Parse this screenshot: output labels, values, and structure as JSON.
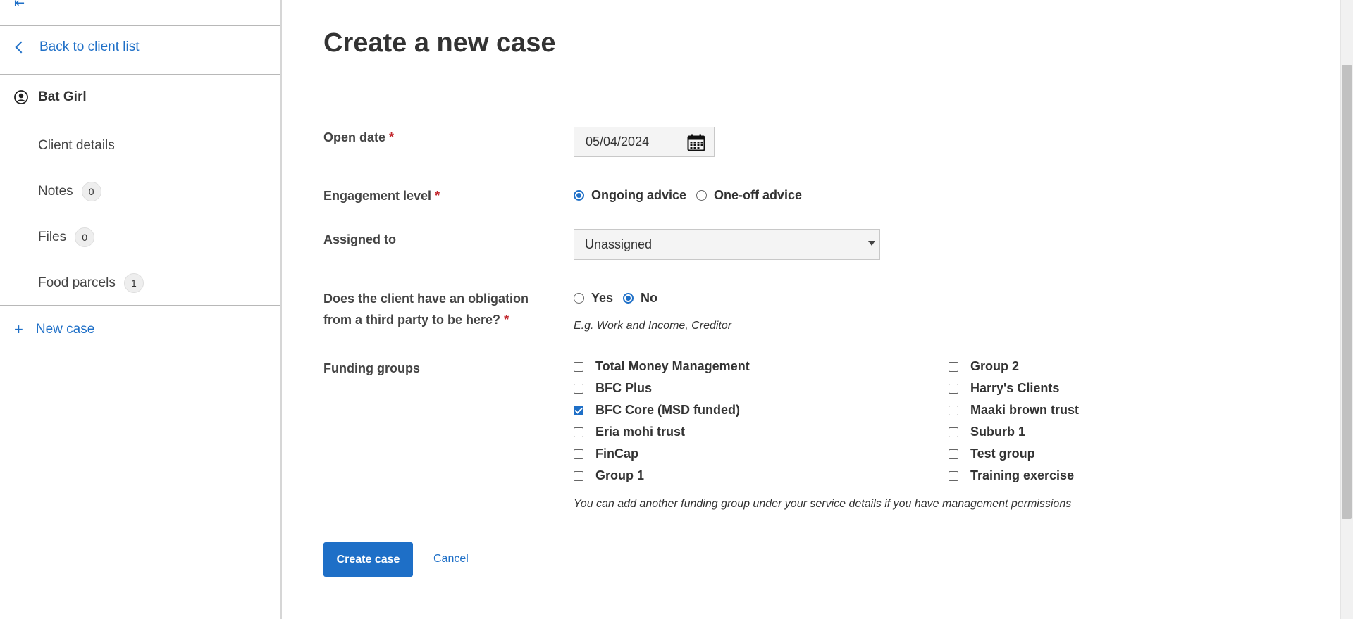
{
  "sidebar": {
    "back_label": "Back to client list",
    "client_name": "Bat Girl",
    "items": [
      {
        "label": "Client details",
        "count": null
      },
      {
        "label": "Notes",
        "count": "0"
      },
      {
        "label": "Files",
        "count": "0"
      },
      {
        "label": "Food parcels",
        "count": "1"
      }
    ],
    "new_case_label": "New case"
  },
  "form": {
    "title": "Create a new case",
    "open_date": {
      "label": "Open date",
      "required": "*",
      "value": "05/04/2024"
    },
    "engagement": {
      "label": "Engagement level",
      "required": "*",
      "options": [
        "Ongoing advice",
        "One-off advice"
      ],
      "selected": "Ongoing advice"
    },
    "assigned": {
      "label": "Assigned to",
      "value": "Unassigned"
    },
    "obligation": {
      "label_line1": "Does the client have an obligation",
      "label_line2": "from a third party to be here?",
      "required": "*",
      "options": [
        "Yes",
        "No"
      ],
      "selected": "No",
      "hint": "E.g. Work and Income, Creditor"
    },
    "funding": {
      "label": "Funding groups",
      "col1": [
        {
          "label": "Total Money Management",
          "checked": false
        },
        {
          "label": "BFC Plus",
          "checked": false
        },
        {
          "label": "BFC Core (MSD funded)",
          "checked": true
        },
        {
          "label": "Eria mohi trust",
          "checked": false
        },
        {
          "label": "FinCap",
          "checked": false
        },
        {
          "label": "Group 1",
          "checked": false
        }
      ],
      "col2": [
        {
          "label": "Group 2",
          "checked": false
        },
        {
          "label": "Harry's Clients",
          "checked": false
        },
        {
          "label": "Maaki brown trust",
          "checked": false
        },
        {
          "label": "Suburb 1",
          "checked": false
        },
        {
          "label": "Test group",
          "checked": false
        },
        {
          "label": "Training exercise",
          "checked": false
        }
      ],
      "hint": "You can add another funding group under your service details if you have management permissions"
    },
    "create_label": "Create case",
    "cancel_label": "Cancel"
  },
  "colors": {
    "accent": "#1e6fc7",
    "required": "#c2272d"
  }
}
